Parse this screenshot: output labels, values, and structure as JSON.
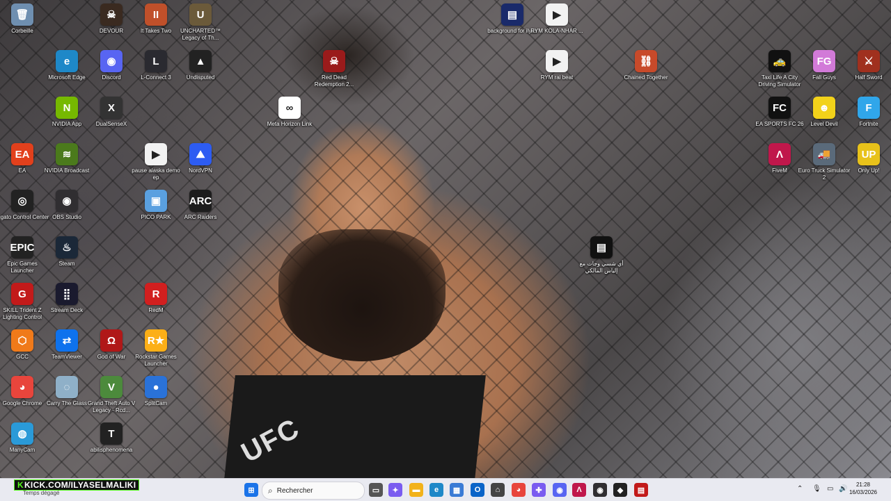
{
  "desktop_icons": [
    {
      "label": "Corbeille",
      "icon": "recycle-bin-icon",
      "color": "#6f8fb0",
      "glyph": "🗑"
    },
    {
      "label": "DEVOUR",
      "icon": "devour-icon",
      "color": "#3a2a20",
      "glyph": "☠"
    },
    {
      "label": "It Takes Two",
      "icon": "it-takes-two-icon",
      "color": "#c0502a",
      "glyph": "II"
    },
    {
      "label": "UNCHARTED™ Legacy of Th...",
      "icon": "uncharted-icon",
      "color": "#6b5a3a",
      "glyph": "U"
    },
    {
      "label": "Microsoft Edge",
      "icon": "edge-icon",
      "color": "#1e88c8",
      "glyph": "e"
    },
    {
      "label": "Discord",
      "icon": "discord-icon",
      "color": "#5865f2",
      "glyph": "◉"
    },
    {
      "label": "L-Connect 3",
      "icon": "lconnect-icon",
      "color": "#2a2a30",
      "glyph": "L"
    },
    {
      "label": "Undisputed",
      "icon": "undisputed-icon",
      "color": "#222",
      "glyph": "▲"
    },
    {
      "label": "NVIDIA App",
      "icon": "nvidia-app-icon",
      "color": "#76b900",
      "glyph": "N"
    },
    {
      "label": "DualSenseX",
      "icon": "dualsensex-icon",
      "color": "#333",
      "glyph": "X"
    },
    {
      "label": "EA",
      "icon": "ea-icon",
      "color": "#e2401c",
      "glyph": "EA"
    },
    {
      "label": "NVIDIA Broadcast",
      "icon": "nvidia-broadcast-icon",
      "color": "#4b7a1c",
      "glyph": "≋"
    },
    {
      "label": "pause alaska demo ep",
      "icon": "audio-file-icon",
      "color": "#f2f2f2",
      "glyph": "▶"
    },
    {
      "label": "NordVPN",
      "icon": "nordvpn-icon",
      "color": "#2d5cf2",
      "glyph": "⛰"
    },
    {
      "label": "Elgato Control Center",
      "icon": "elgato-icon",
      "color": "#222",
      "glyph": "◎"
    },
    {
      "label": "OBS Studio",
      "icon": "obs-icon",
      "color": "#302e31",
      "glyph": "◉"
    },
    {
      "label": "PICO PARK",
      "icon": "pico-park-icon",
      "color": "#5aa0e0",
      "glyph": "▣"
    },
    {
      "label": "ARC Raiders",
      "icon": "arc-raiders-icon",
      "color": "#1d1d1d",
      "glyph": "ARC"
    },
    {
      "label": "Epic Games Launcher",
      "icon": "epic-games-icon",
      "color": "#222",
      "glyph": "EPIC"
    },
    {
      "label": "Steam",
      "icon": "steam-icon",
      "color": "#1b2838",
      "glyph": "♨"
    },
    {
      "label": "SKILL Trident Z Lighting Control",
      "icon": "gskill-icon",
      "color": "#c21a1a",
      "glyph": "G"
    },
    {
      "label": "Stream Deck",
      "icon": "stream-deck-icon",
      "color": "#1a1a2e",
      "glyph": "⣿"
    },
    {
      "label": "RedM",
      "icon": "redm-icon",
      "color": "#d21f1f",
      "glyph": "R"
    },
    {
      "label": "GCC",
      "icon": "gcc-icon",
      "color": "#f07a1a",
      "glyph": "⬡"
    },
    {
      "label": "TeamViewer",
      "icon": "teamviewer-icon",
      "color": "#0e72ed",
      "glyph": "⇄"
    },
    {
      "label": "God of War",
      "icon": "god-of-war-icon",
      "color": "#b01818",
      "glyph": "Ω"
    },
    {
      "label": "Rockstar Games Launcher",
      "icon": "rockstar-icon",
      "color": "#fcaf17",
      "glyph": "R★"
    },
    {
      "label": "Google Chrome",
      "icon": "chrome-icon",
      "color": "#e8453c",
      "glyph": "◕"
    },
    {
      "label": "Carry The Glass",
      "icon": "carry-glass-icon",
      "color": "#8fb0c8",
      "glyph": "◌"
    },
    {
      "label": "Grand Theft Auto V Legacy - Rcd...",
      "icon": "gta-v-icon",
      "color": "#4c8a3c",
      "glyph": "V"
    },
    {
      "label": "SplitCam",
      "icon": "splitcam-icon",
      "color": "#2a72d8",
      "glyph": "●"
    },
    {
      "label": "ManyCam",
      "icon": "manycam-icon",
      "color": "#2a9ad8",
      "glyph": "◍"
    },
    {
      "label": "abilisphenomena",
      "icon": "abilis-icon",
      "color": "#222",
      "glyph": "T"
    },
    {
      "label": "Red Dead Redemption 2...",
      "icon": "rdr2-icon",
      "color": "#9a1b1b",
      "glyph": "☠"
    },
    {
      "label": "Meta Horizon Link",
      "icon": "meta-icon",
      "color": "#ffffff",
      "glyph": "∞"
    },
    {
      "label": "background for ilyas",
      "icon": "video-file-icon",
      "color": "#1a2a6a",
      "glyph": "▤"
    },
    {
      "label": "RYM KOLA-NHAR ...",
      "icon": "audio-file-icon",
      "color": "#f2f2f2",
      "glyph": "▶"
    },
    {
      "label": "RYM rai beat",
      "icon": "audio-file-icon",
      "color": "#f2f2f2",
      "glyph": "▶"
    },
    {
      "label": "Chained Together",
      "icon": "chained-together-icon",
      "color": "#c84a2a",
      "glyph": "⛓"
    },
    {
      "label": "أي شسي وجات مع إلياس المالكي",
      "icon": "video-file-icon",
      "color": "#111",
      "glyph": "▤"
    },
    {
      "label": "Taxi Life A City Driving Simulator",
      "icon": "taxi-life-icon",
      "color": "#111",
      "glyph": "🚕"
    },
    {
      "label": "Fall Guys",
      "icon": "fall-guys-icon",
      "color": "#d27ad8",
      "glyph": "FG"
    },
    {
      "label": "Half Sword",
      "icon": "half-sword-icon",
      "color": "#a0301e",
      "glyph": "⚔"
    },
    {
      "label": "EA SPORTS FC 26",
      "icon": "fc26-icon",
      "color": "#111",
      "glyph": "FC"
    },
    {
      "label": "Level Devil",
      "icon": "level-devil-icon",
      "color": "#f2d21a",
      "glyph": "☻"
    },
    {
      "label": "Fortnite",
      "icon": "fortnite-icon",
      "color": "#30a6ea",
      "glyph": "F"
    },
    {
      "label": "FiveM",
      "icon": "fivem-icon",
      "color": "#c0174b",
      "glyph": "Λ"
    },
    {
      "label": "Euro Truck Simulator 2",
      "icon": "ets2-icon",
      "color": "#5a6a7a",
      "glyph": "🚚"
    },
    {
      "label": "Only Up!",
      "icon": "only-up-icon",
      "color": "#e8c21a",
      "glyph": "UP"
    }
  ],
  "taskbar": {
    "kick_banner": "KICK.COM/ILYASELMALIKI",
    "kick_prefix": "K",
    "weather": "Temps dégagé",
    "search_placeholder": "Rechercher",
    "clock_time": "21:28",
    "clock_date": "16/03/2026",
    "apps": [
      {
        "name": "windows-start-icon",
        "color": "#1a73e8",
        "glyph": "⊞"
      },
      {
        "name": "task-view-icon",
        "color": "#555",
        "glyph": "▭"
      },
      {
        "name": "copilot-icon",
        "color": "#7a5cf0",
        "glyph": "✦"
      },
      {
        "name": "file-explorer-icon",
        "color": "#f2b21a",
        "glyph": "▬"
      },
      {
        "name": "edge-icon",
        "color": "#1e88c8",
        "glyph": "e"
      },
      {
        "name": "store-icon",
        "color": "#3a7bd5",
        "glyph": "▦"
      },
      {
        "name": "outlook-icon",
        "color": "#0a64c8",
        "glyph": "O"
      },
      {
        "name": "inbox-icon",
        "color": "#444",
        "glyph": "⌂"
      },
      {
        "name": "chrome-icon",
        "color": "#e8453c",
        "glyph": "◕"
      },
      {
        "name": "gamepad-icon",
        "color": "#7a5cf0",
        "glyph": "✚"
      },
      {
        "name": "discord-icon",
        "color": "#5865f2",
        "glyph": "◉"
      },
      {
        "name": "fivem-icon",
        "color": "#c0174b",
        "glyph": "Λ"
      },
      {
        "name": "obs-icon",
        "color": "#302e31",
        "glyph": "◉"
      },
      {
        "name": "arc-raiders-icon",
        "color": "#222",
        "glyph": "◆"
      },
      {
        "name": "meter-app-icon",
        "color": "#c21a1a",
        "glyph": "▤"
      }
    ],
    "tray": [
      {
        "name": "chevron-up-icon",
        "glyph": "⌃"
      },
      {
        "name": "microphone-icon",
        "glyph": "🎙"
      },
      {
        "name": "network-icon",
        "glyph": "▭"
      },
      {
        "name": "volume-icon",
        "glyph": "🔊"
      }
    ]
  },
  "wallpaper": {
    "logo_text": "UFC"
  }
}
